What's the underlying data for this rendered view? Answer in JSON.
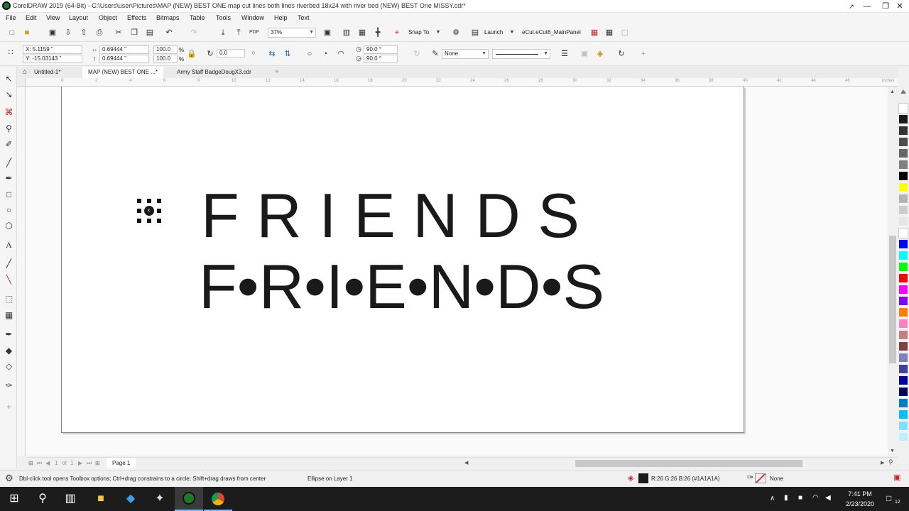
{
  "window": {
    "title": "CorelDRAW 2019 (64-Bit) - C:\\Users\\user\\Pictures\\MAP (NEW) BEST ONE map cut lines both lines  riverbed 18x24 with river bed (NEW) BEST One MISSY.cdr*",
    "minimize": "—",
    "restore": "❐",
    "close": "✕"
  },
  "menu": [
    "File",
    "Edit",
    "View",
    "Layout",
    "Object",
    "Effects",
    "Bitmaps",
    "Table",
    "Tools",
    "Window",
    "Help",
    "Text"
  ],
  "toolbar": {
    "zoom": "37%",
    "snap_to": "Snap To",
    "launch": "Launch",
    "ecut": "eCut.eCut6_MainPanel"
  },
  "propbar": {
    "x": "X: 5.1159 \"",
    "y": "Y: -15.03143 \"",
    "width": "0.69444 \"",
    "height": "0.69444 \"",
    "scale_w": "100.0",
    "scale_h": "100.0",
    "pct": "%",
    "rotation": "0.0",
    "angle1": "90.0 °",
    "angle2": "90.0 °",
    "outline": "None"
  },
  "tabs": [
    "Untitled-1*",
    "MAP (NEW) BEST ONE ...*",
    "Army Staff BadgeDougX3.cdr"
  ],
  "canvas": {
    "line1": "F R I E N D S",
    "line2": "F•R•I•E•N•D•S"
  },
  "ruler_units": "inches",
  "ruler_ticks": [
    "0",
    "2",
    "4",
    "6",
    "8",
    "10",
    "12",
    "14",
    "16",
    "18",
    "20",
    "22",
    "24",
    "26",
    "28",
    "30",
    "32",
    "34",
    "36",
    "38",
    "40",
    "42",
    "44",
    "46"
  ],
  "pagebar": {
    "page_num": "1",
    "of": "of",
    "page_total": "1",
    "page_tab": "Page 1"
  },
  "status": {
    "hint": "Dbl-click tool opens Toolbox options; Ctrl+drag constrains to a circle; Shift+drag draws from center",
    "object": "Ellipse on Layer 1",
    "fill": "R:26 G:26 B:26 (#1A1A1A)",
    "outline": "None"
  },
  "taskbar": {
    "time": "7:41 PM",
    "date": "2/23/2020",
    "notifications": "12"
  },
  "palette": [
    "#ffffff",
    "#1a1a1a",
    "#333333",
    "#4d4d4d",
    "#666666",
    "#808080",
    "#000000",
    "#ffff00",
    "#b3b3b3",
    "#cccccc",
    "#e6e6e6",
    "#ffffff",
    "#0000ff",
    "#00ffff",
    "#00ff00",
    "#ff0000",
    "#ff00ff",
    "#8000ff",
    "#ff8000",
    "#ff80c0",
    "#c08080",
    "#804040",
    "#8080c0",
    "#4040a0",
    "#0000a0",
    "#000060",
    "#0080c0",
    "#00c0ff",
    "#80e0ff",
    "#c0f0ff"
  ],
  "colors": {
    "accent": "#1a1a1a",
    "taskbar": "#1c1c1c",
    "selected_tab": "#ffffff"
  }
}
